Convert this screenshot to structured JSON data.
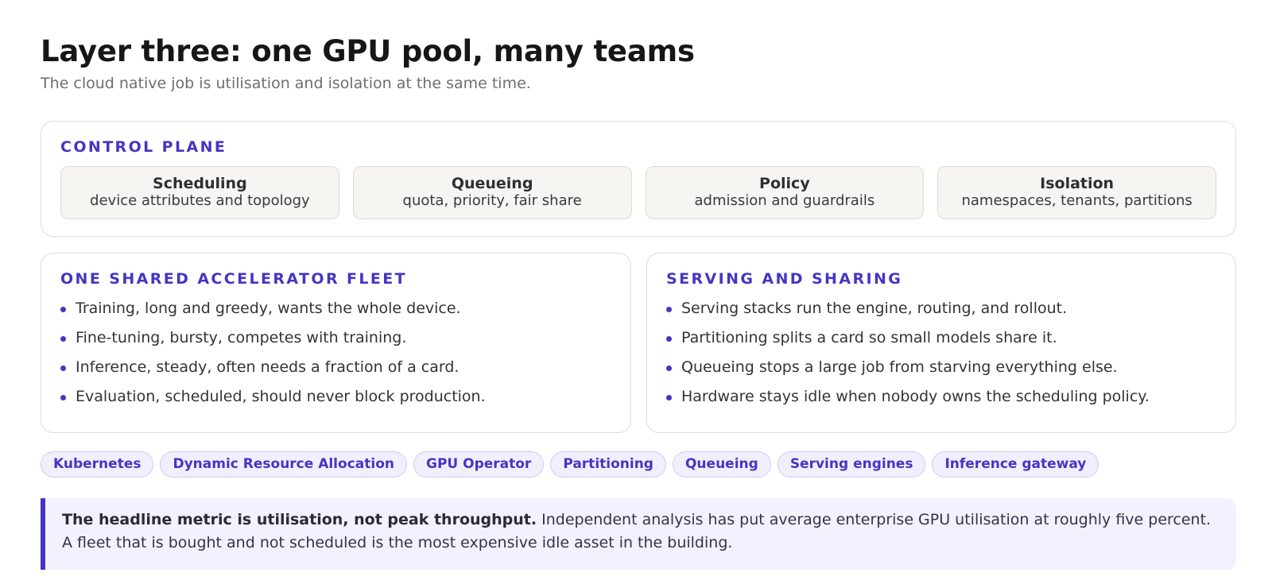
{
  "header": {
    "title": "Layer three: one GPU pool, many teams",
    "subtitle": "The cloud native job is utilisation and isolation at the same time."
  },
  "control_plane": {
    "label": "CONTROL PLANE",
    "tiles": [
      {
        "title": "Scheduling",
        "sub": "device attributes and topology"
      },
      {
        "title": "Queueing",
        "sub": "quota, priority, fair share"
      },
      {
        "title": "Policy",
        "sub": "admission and guardrails"
      },
      {
        "title": "Isolation",
        "sub": "namespaces, tenants, partitions"
      }
    ]
  },
  "fleet": {
    "label": "ONE SHARED ACCELERATOR FLEET",
    "items": [
      "Training, long and greedy, wants the whole device.",
      "Fine-tuning, bursty, competes with training.",
      "Inference, steady, often needs a fraction of a card.",
      "Evaluation, scheduled, should never block production."
    ]
  },
  "serving": {
    "label": "SERVING AND SHARING",
    "items": [
      "Serving stacks run the engine, routing, and rollout.",
      "Partitioning splits a card so small models share it.",
      "Queueing stops a large job from starving everything else.",
      "Hardware stays idle when nobody owns the scheduling policy."
    ]
  },
  "tags": [
    "Kubernetes",
    "Dynamic Resource Allocation",
    "GPU Operator",
    "Partitioning",
    "Queueing",
    "Serving engines",
    "Inference gateway"
  ],
  "callout": {
    "bold": "The headline metric is utilisation, not peak throughput.",
    "text": " Independent analysis has put average enterprise GPU utilisation at roughly five percent. A fleet that is bought and not scheduled is the most expensive idle asset in the building."
  },
  "colors": {
    "accent": "#4535c4",
    "tile_bg": "#f6f5f1",
    "callout_bg": "#f3f1fd"
  }
}
